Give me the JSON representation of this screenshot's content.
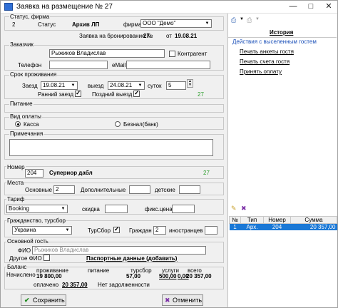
{
  "window": {
    "title": "Заявка на размещение № 27"
  },
  "status_group": {
    "label": "Статус, фирма",
    "number": "2",
    "status_label": "Статус",
    "status_value": "Архив ЛП",
    "firm_label": "фирма",
    "firm_value": "ООО \"Демо\""
  },
  "booking": {
    "label": "Заявка на бронирование №",
    "number": "27",
    "from_label": "от",
    "date": "19.08.21"
  },
  "customer": {
    "label": "Заказчик",
    "name": "Рыжиков Владислав",
    "counterparty_label": "Контрагент",
    "phone_label": "Телефон",
    "phone_value": "",
    "email_label": "eMail",
    "email_value": ""
  },
  "stay": {
    "label": "Срок проживания",
    "checkin_label": "Заезд",
    "checkin_value": "19.08.21",
    "checkout_label": "выезд",
    "checkout_value": "24.08.21",
    "nights_label": "суток",
    "nights_value": "5",
    "early_label": "Ранний заезд",
    "late_label": "Поздний выезд",
    "stay_count": "27"
  },
  "meals": {
    "label": "Питание"
  },
  "payment": {
    "label": "Вид оплаты",
    "cash_label": "Касса",
    "cashless_label": "Безнал(банк)"
  },
  "notes": {
    "label": "Примечания",
    "value": ""
  },
  "room": {
    "label": "Номер",
    "number": "204",
    "type": "Супериор дабл",
    "count": "27"
  },
  "places": {
    "label": "Места",
    "main_label": "Основные",
    "main_value": "2",
    "extra_label": "Дополнительные",
    "extra_value": "",
    "kids_label": "детские",
    "kids_value": ""
  },
  "tariff": {
    "label": "Тариф",
    "value": "Booking",
    "discount_label": "скидка",
    "discount_value": "",
    "fixed_label": "фикс.цена",
    "fixed_value": ""
  },
  "citizenship": {
    "label": "Гражданство, турсбор",
    "country": "Украина",
    "tourtax_label": "ТурСбор",
    "citizens_label": "Граждан",
    "citizens_value": "2",
    "foreigners_label": "иностранцев",
    "foreigners_value": ""
  },
  "guest": {
    "label": "Основной гость",
    "fio_label": "ФИО",
    "fio_value": "Рыжиков Владислав",
    "other_fio_label": "Другое ФИО",
    "passport_link": "Паспортные данные (добавить)"
  },
  "balance": {
    "label": "Баланс",
    "accrued_label": "Начислено",
    "cols": [
      {
        "label": "проживание",
        "value": "19 800,00"
      },
      {
        "label": "питание",
        "value": "57,00"
      },
      {
        "label": "турсбор",
        "value": "500,00"
      },
      {
        "label": "услуги",
        "value": "0,00"
      },
      {
        "label": "всего",
        "value": "20 357,00"
      }
    ],
    "paid_label": "оплачено",
    "paid_value": "20 357,00",
    "no_debt": "Нет задолженности"
  },
  "buttons": {
    "save": "Сохранить",
    "cancel": "Отменить"
  },
  "history": {
    "title": "История",
    "actions_header": "Действия с выселенным гостем",
    "links": [
      "Печать анкеты гостя",
      "Печать счета гостя",
      "Принять оплату"
    ],
    "table": {
      "headers": [
        "№",
        "Тип",
        "Номер",
        "Сумма"
      ],
      "rows": [
        {
          "n": "1",
          "type": "Арх.",
          "room": "204",
          "sum": "20 357,00"
        }
      ]
    }
  },
  "colors": {
    "selection": "#1a78d6",
    "accent_green": "#2a9d2a",
    "link_blue": "#1a4fb8"
  }
}
